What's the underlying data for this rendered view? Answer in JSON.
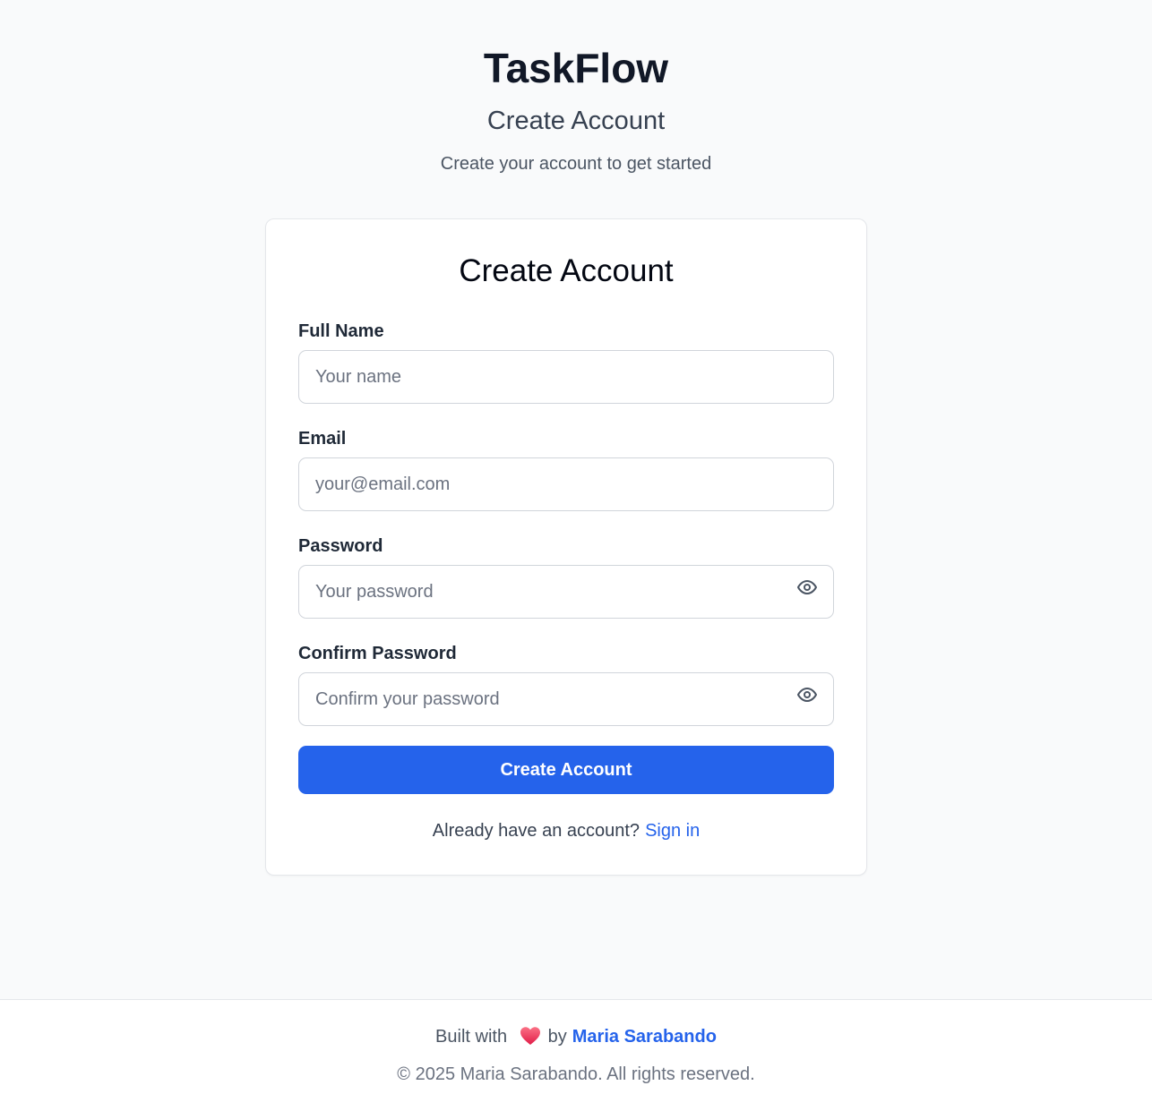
{
  "header": {
    "brand": "TaskFlow",
    "heading": "Create Account",
    "subtitle": "Create your account to get started"
  },
  "form": {
    "title": "Create Account",
    "fields": [
      {
        "label": "Full Name",
        "placeholder": "Your name",
        "value": ""
      },
      {
        "label": "Email",
        "placeholder": "your@email.com",
        "value": ""
      },
      {
        "label": "Password",
        "placeholder": "Your password",
        "value": ""
      },
      {
        "label": "Confirm Password",
        "placeholder": "Confirm your password",
        "value": ""
      }
    ],
    "submit_label": "Create Account",
    "signin_prompt": "Already have an account?",
    "signin_link": "Sign in"
  },
  "footer": {
    "built_with": "Built with",
    "by": "by",
    "author": "Maria Sarabando",
    "copyright": "© 2025 Maria Sarabando. All rights reserved."
  },
  "icons": {
    "password_toggle": "eye-icon",
    "confirm_toggle": "eye-icon",
    "heart": "heart-icon"
  },
  "colors": {
    "accent": "#2563eb",
    "background": "#f9fafb",
    "heart": "#e11d48"
  }
}
